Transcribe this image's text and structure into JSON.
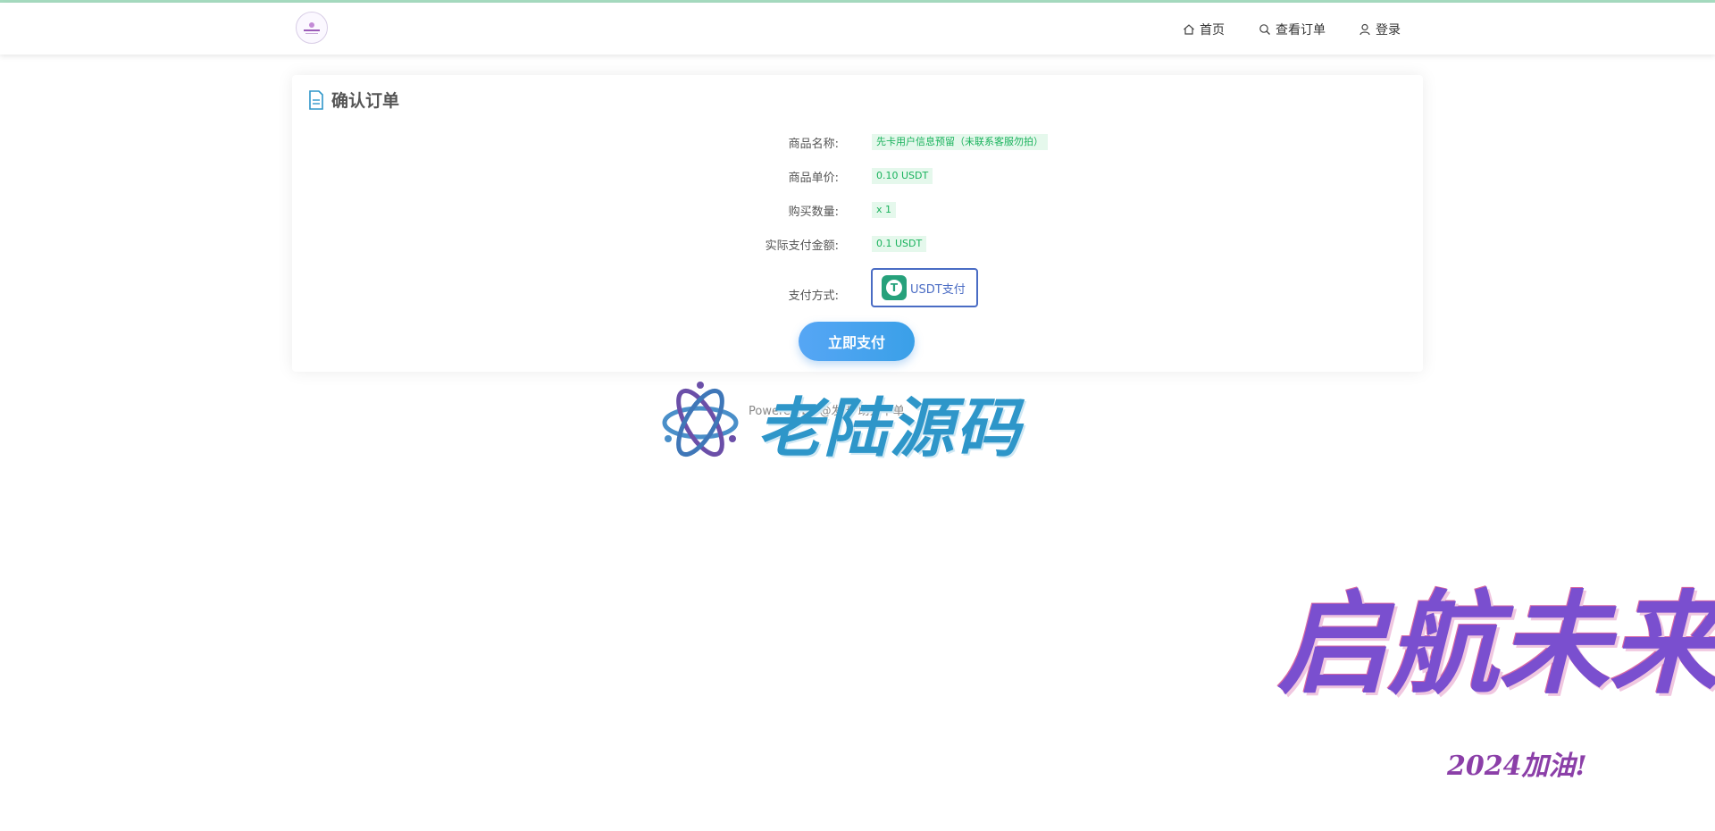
{
  "nav": {
    "home": "首页",
    "orders": "查看订单",
    "login": "登录"
  },
  "card": {
    "title": "确认订单",
    "rows": [
      {
        "label": "商品名称:",
        "value": "先卡用户信息预留（未联系客服勿拍）"
      },
      {
        "label": "商品单价:",
        "value": "0.10 USDT"
      },
      {
        "label": "购买数量:",
        "value": "x 1"
      },
      {
        "label": "实际支付金额:",
        "value": "0.1 USDT"
      }
    ],
    "pay_label": "支付方式:",
    "pay_method": "USDT支付",
    "submit": "立即支付"
  },
  "footer": {
    "text": "Powered by @发卡 助力下单"
  },
  "watermarks": {
    "brand": "老陆源码",
    "slogan": "启航未来",
    "slogan_sub": "2024加油!"
  },
  "colors": {
    "accent": "#3aa0e8",
    "value_green": "#19b25c",
    "pay_border": "#4a6cc4",
    "tether": "#26a17b"
  },
  "icons": {
    "home": "home-icon",
    "search": "search-icon",
    "user": "user-icon",
    "doc": "document-icon",
    "tether": "tether-icon"
  }
}
